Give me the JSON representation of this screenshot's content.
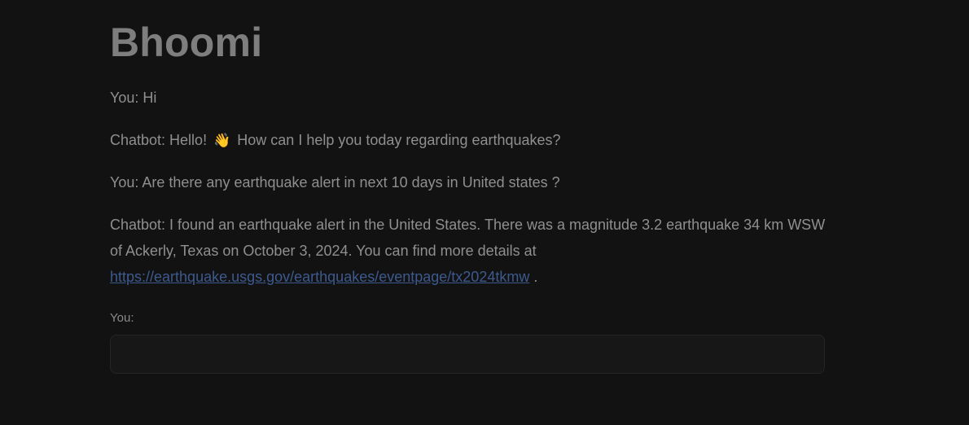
{
  "app": {
    "title": "Bhoomi"
  },
  "messages": [
    {
      "text": "You: Hi"
    },
    {
      "prefix": "Chatbot: Hello!",
      "emoji": "👋",
      "suffix": "How can I help you today regarding earthquakes?"
    },
    {
      "text": "You: Are there any earthquake alert in next 10 days in United states ?"
    },
    {
      "text": "Chatbot: I found an earthquake alert in the United States. There was a magnitude 3.2 earthquake 34 km WSW of Ackerly, Texas on October 3, 2024. You can find more details at ",
      "link": "https://earthquake.usgs.gov/earthquakes/eventpage/tx2024tkmw",
      "after_link": " ."
    }
  ],
  "input": {
    "label": "You:",
    "value": "",
    "placeholder": ""
  },
  "colors": {
    "background": "#121212",
    "text": "#8f8f8f",
    "link": "#3d5a8f"
  }
}
